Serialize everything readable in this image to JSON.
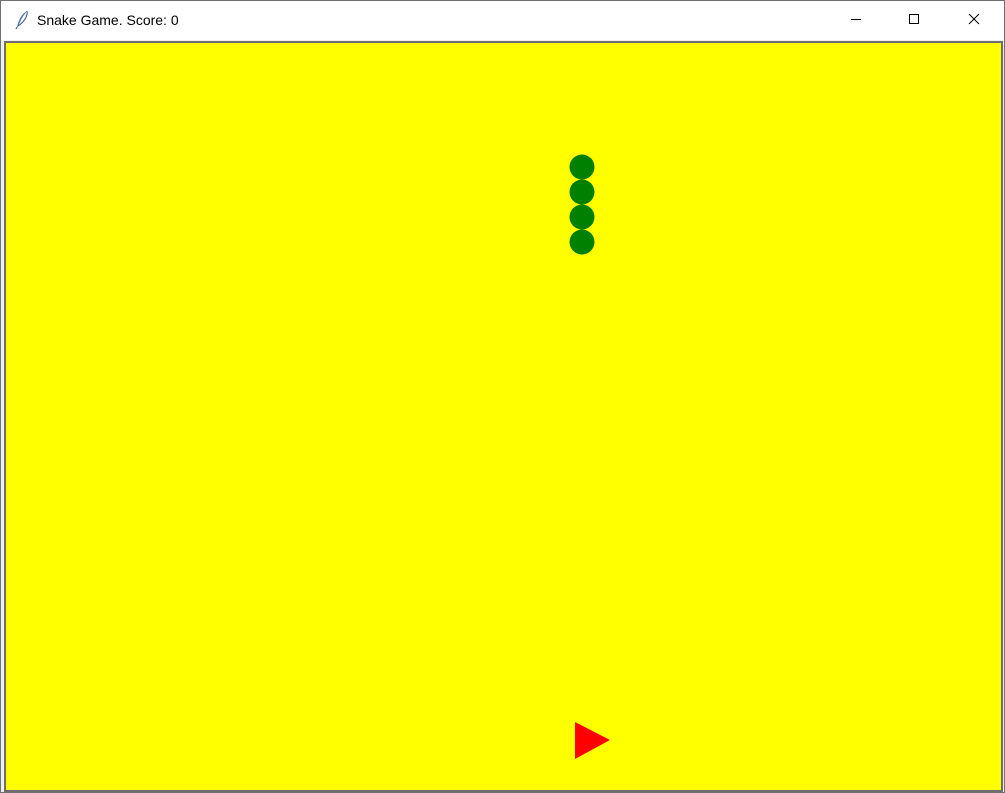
{
  "window": {
    "title": "Snake Game. Score: 0",
    "app_icon": "feather-icon",
    "controls": {
      "minimize_icon": "minimize-icon",
      "maximize_icon": "maximize-icon",
      "close_icon": "close-icon"
    }
  },
  "game": {
    "score": 0,
    "background_color": "#ffff00",
    "snake_color": "#008000",
    "food_color": "#ff0000",
    "snake_length": 4,
    "food_icon": "triangle-right-icon"
  }
}
